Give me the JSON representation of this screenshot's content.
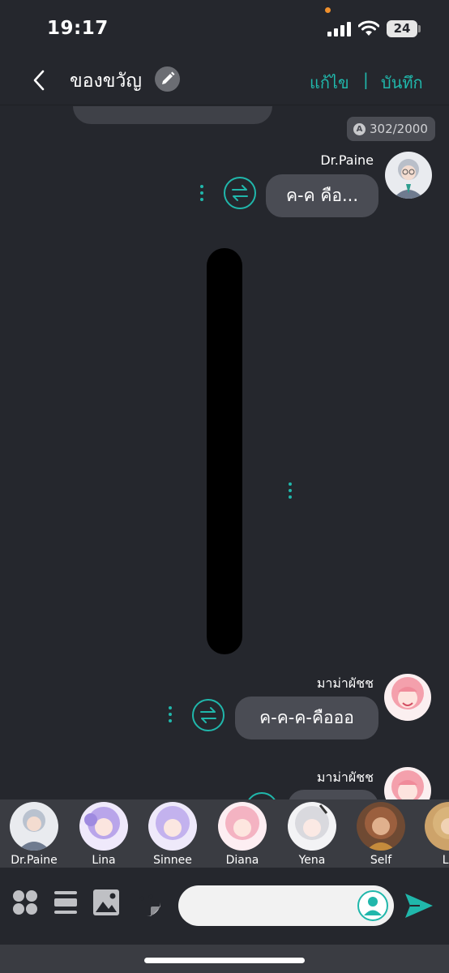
{
  "status_bar": {
    "time": "19:17",
    "battery": "24"
  },
  "header": {
    "title": "ของขวัญ",
    "edit_label": "แก้ไข",
    "separator": "|",
    "save_label": "บันทึก"
  },
  "chat": {
    "char_counter": "302/2000",
    "messages": [
      {
        "sender": "Dr.Paine",
        "text": "ค-ค คือ..."
      },
      {
        "sender": "มาม่าผัชช",
        "text": "ค-ค-ค-คือออ"
      },
      {
        "sender": "มาม่าผัชช",
        "text": ""
      }
    ]
  },
  "characters": [
    {
      "name": "Dr.Paine",
      "color": "#b9c2cf"
    },
    {
      "name": "Lina",
      "color": "#b9a5ea"
    },
    {
      "name": "Sinnee",
      "color": "#c3b2ee"
    },
    {
      "name": "Diana",
      "color": "#f4b3c2"
    },
    {
      "name": "Yena",
      "color": "#d9d9de"
    },
    {
      "name": "Self",
      "color": "#9b5f3e"
    },
    {
      "name": "Lu",
      "color": "#d9b47b"
    }
  ],
  "input": {
    "placeholder": ""
  },
  "colors": {
    "accent": "#20b7ab",
    "background": "#25272d",
    "bubble": "#4a4c54"
  }
}
